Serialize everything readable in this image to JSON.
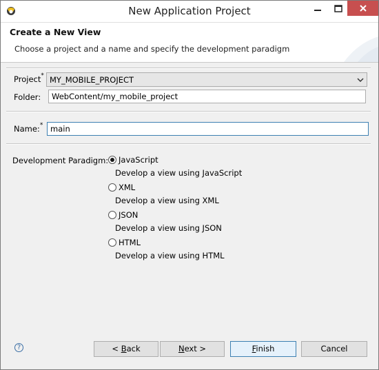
{
  "window": {
    "title": "New Application Project"
  },
  "banner": {
    "title": "Create a New View",
    "description": "Choose a project and a name and specify the development paradigm"
  },
  "form": {
    "project_label": "Project",
    "project_value": "MY_MOBILE_PROJECT",
    "folder_label": "Folder:",
    "folder_value": "WebContent/my_mobile_project",
    "name_label": "Name:",
    "name_value": "main",
    "required_marker": "*"
  },
  "paradigm": {
    "label": "Development Paradigm:",
    "selected": "JavaScript",
    "options": [
      {
        "label": "JavaScript",
        "description": "Develop a view using JavaScript"
      },
      {
        "label": "XML",
        "description": "Develop a view using XML"
      },
      {
        "label": "JSON",
        "description": "Develop a view using JSON"
      },
      {
        "label": "HTML",
        "description": "Develop a view using HTML"
      }
    ]
  },
  "buttons": {
    "back_prefix": "< ",
    "back_mnemonic": "B",
    "back_rest": "ack",
    "next_mnemonic": "N",
    "next_rest": "ext >",
    "finish_mnemonic": "F",
    "finish_rest": "inish",
    "cancel": "Cancel",
    "help": "?"
  },
  "icons": {
    "app": "eclipse-app-icon",
    "minimize": "minimize-icon",
    "maximize": "maximize-icon",
    "close": "close-icon",
    "help": "help-icon",
    "dropdown": "chevron-down-icon"
  },
  "colors": {
    "close_button": "#c74f4f",
    "focus_border": "#3c7fb1",
    "help_icon": "#3a6ea5"
  }
}
